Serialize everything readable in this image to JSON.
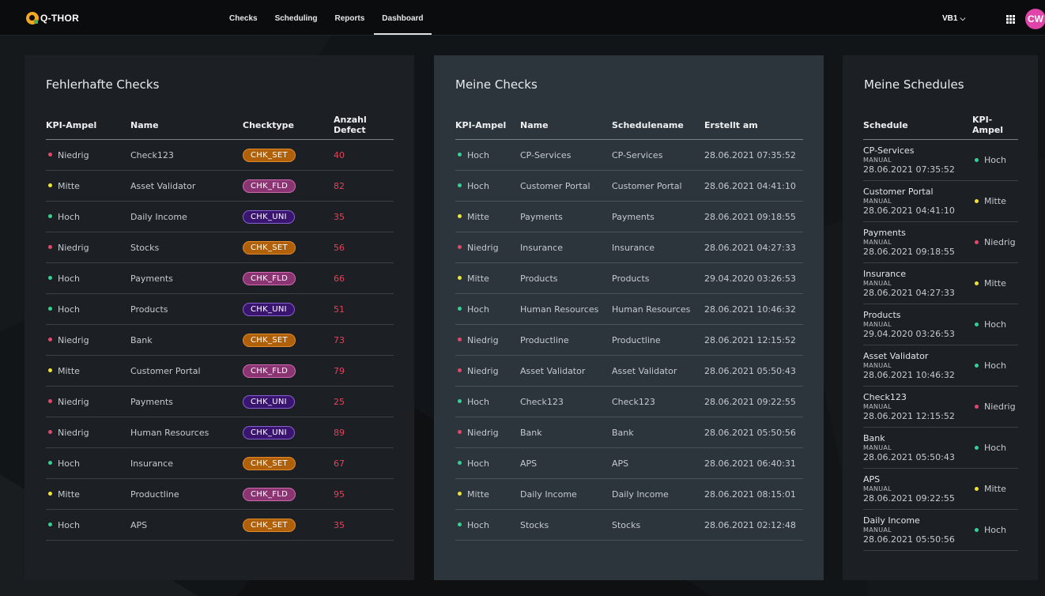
{
  "colors": {
    "hoch": "#2ed48f",
    "mitte": "#f0e42c",
    "niedrig": "#e8456a"
  },
  "header": {
    "logo": "Q-THOR",
    "nav": [
      {
        "label": "Checks"
      },
      {
        "label": "Scheduling"
      },
      {
        "label": "Reports"
      },
      {
        "label": "Dashboard",
        "active": true
      }
    ],
    "org": "VB1",
    "avatar": "CW"
  },
  "fehlerhafte": {
    "title": "Fehlerhafte Checks",
    "columns": [
      "KPI-Ampel",
      "Name",
      "Checktype",
      "Anzahl Defect"
    ],
    "rows": [
      {
        "kpi": "Niedrig",
        "name": "Check123",
        "type": "CHK_SET",
        "defects": "40"
      },
      {
        "kpi": "Mitte",
        "name": "Asset Validator",
        "type": "CHK_FLD",
        "defects": "82"
      },
      {
        "kpi": "Hoch",
        "name": "Daily Income",
        "type": "CHK_UNI",
        "defects": "35"
      },
      {
        "kpi": "Niedrig",
        "name": "Stocks",
        "type": "CHK_SET",
        "defects": "56"
      },
      {
        "kpi": "Hoch",
        "name": "Payments",
        "type": "CHK_FLD",
        "defects": "66"
      },
      {
        "kpi": "Hoch",
        "name": "Products",
        "type": "CHK_UNI",
        "defects": "51"
      },
      {
        "kpi": "Niedrig",
        "name": "Bank",
        "type": "CHK_SET",
        "defects": "73"
      },
      {
        "kpi": "Mitte",
        "name": "Customer Portal",
        "type": "CHK_FLD",
        "defects": "79"
      },
      {
        "kpi": "Niedrig",
        "name": "Payments",
        "type": "CHK_UNI",
        "defects": "25"
      },
      {
        "kpi": "Niedrig",
        "name": "Human Resources",
        "type": "CHK_UNI",
        "defects": "89"
      },
      {
        "kpi": "Hoch",
        "name": "Insurance",
        "type": "CHK_SET",
        "defects": "67"
      },
      {
        "kpi": "Mitte",
        "name": "Productline",
        "type": "CHK_FLD",
        "defects": "95"
      },
      {
        "kpi": "Hoch",
        "name": "APS",
        "type": "CHK_SET",
        "defects": "35"
      }
    ]
  },
  "meine_checks": {
    "title": "Meine Checks",
    "columns": [
      "KPI-Ampel",
      "Name",
      "Schedulename",
      "Erstellt am"
    ],
    "rows": [
      {
        "kpi": "Hoch",
        "name": "CP-Services",
        "schedule": "CP-Services",
        "created": "28.06.2021 07:35:52"
      },
      {
        "kpi": "Hoch",
        "name": "Customer Portal",
        "schedule": "Customer Portal",
        "created": "28.06.2021 04:41:10"
      },
      {
        "kpi": "Mitte",
        "name": "Payments",
        "schedule": "Payments",
        "created": "28.06.2021 09:18:55"
      },
      {
        "kpi": "Niedrig",
        "name": "Insurance",
        "schedule": "Insurance",
        "created": "28.06.2021 04:27:33"
      },
      {
        "kpi": "Mitte",
        "name": "Products",
        "schedule": "Products",
        "created": "29.04.2020 03:26:53"
      },
      {
        "kpi": "Hoch",
        "name": "Human Resources",
        "schedule": "Human Resources",
        "created": "28.06.2021 10:46:32"
      },
      {
        "kpi": "Niedrig",
        "name": "Productline",
        "schedule": "Productline",
        "created": "28.06.2021 12:15:52"
      },
      {
        "kpi": "Niedrig",
        "name": "Asset Validator",
        "schedule": "Asset Validator",
        "created": "28.06.2021 05:50:43"
      },
      {
        "kpi": "Hoch",
        "name": "Check123",
        "schedule": "Check123",
        "created": "28.06.2021 09:22:55"
      },
      {
        "kpi": "Niedrig",
        "name": "Bank",
        "schedule": "Bank",
        "created": "28.06.2021 05:50:56"
      },
      {
        "kpi": "Hoch",
        "name": "APS",
        "schedule": "APS",
        "created": "28.06.2021 06:40:31"
      },
      {
        "kpi": "Mitte",
        "name": "Daily Income",
        "schedule": "Daily Income",
        "created": "28.06.2021 08:15:01"
      },
      {
        "kpi": "Hoch",
        "name": "Stocks",
        "schedule": "Stocks",
        "created": "28.06.2021 02:12:48"
      }
    ]
  },
  "meine_schedules": {
    "title": "Meine Schedules",
    "columns": [
      "Schedule",
      "KPI-Ampel"
    ],
    "rows": [
      {
        "name": "CP-Services",
        "type": "MANUAL",
        "date": "28.06.2021 07:35:52",
        "kpi": "Hoch"
      },
      {
        "name": "Customer Portal",
        "type": "MANUAL",
        "date": "28.06.2021 04:41:10",
        "kpi": "Mitte"
      },
      {
        "name": "Payments",
        "type": "MANUAL",
        "date": "28.06.2021 09:18:55",
        "kpi": "Niedrig"
      },
      {
        "name": "Insurance",
        "type": "MANUAL",
        "date": "28.06.2021 04:27:33",
        "kpi": "Mitte"
      },
      {
        "name": "Products",
        "type": "MANUAL",
        "date": "29.04.2020 03:26:53",
        "kpi": "Hoch"
      },
      {
        "name": "Asset Validator",
        "type": "MANUAL",
        "date": "28.06.2021 10:46:32",
        "kpi": "Hoch"
      },
      {
        "name": "Check123",
        "type": "MANUAL",
        "date": "28.06.2021 12:15:52",
        "kpi": "Niedrig"
      },
      {
        "name": "Bank",
        "type": "MANUAL",
        "date": "28.06.2021 05:50:43",
        "kpi": "Hoch"
      },
      {
        "name": "APS",
        "type": "MANUAL",
        "date": "28.06.2021 09:22:55",
        "kpi": "Mitte"
      },
      {
        "name": "Daily Income",
        "type": "MANUAL",
        "date": "28.06.2021 05:50:56",
        "kpi": "Hoch"
      }
    ]
  }
}
